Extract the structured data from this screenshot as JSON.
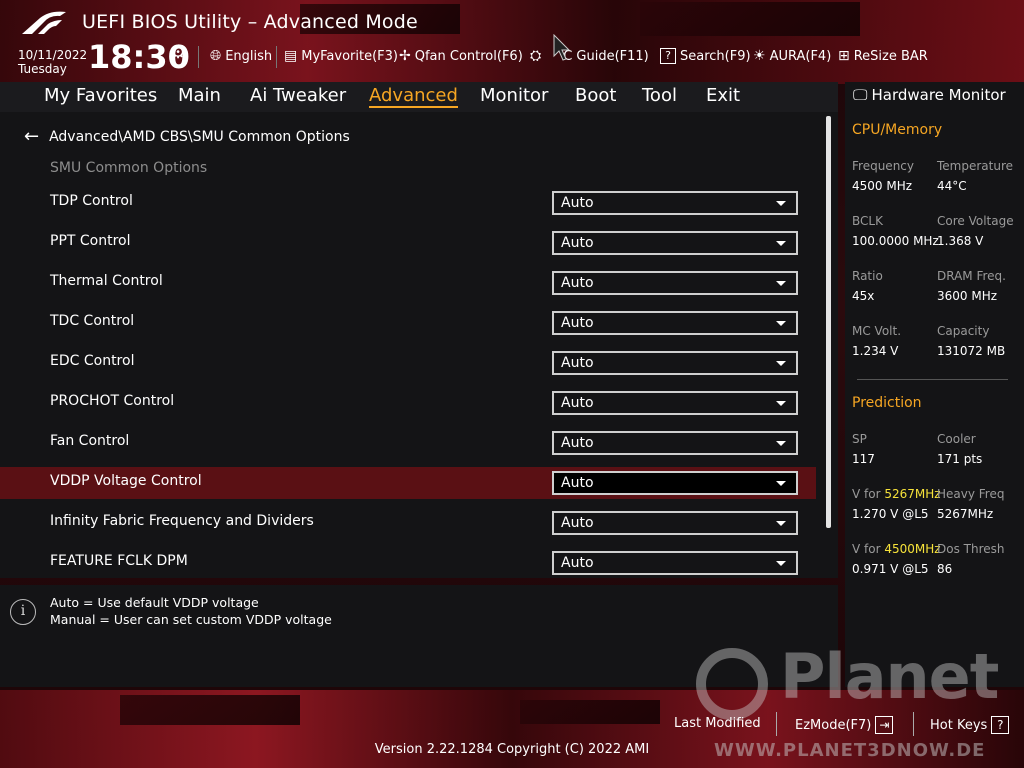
{
  "header": {
    "title": "UEFI BIOS Utility – Advanced Mode",
    "date": "10/11/2022",
    "day": "Tuesday",
    "time": "18:30",
    "toolbar": [
      {
        "label": "English",
        "icon": "globe-icon"
      },
      {
        "label": "MyFavorite(F3)",
        "icon": "favorite-icon"
      },
      {
        "label": "Qfan Control(F6)",
        "icon": "fan-icon"
      },
      {
        "label": "C Guide(F11)",
        "icon": "oc-guide-icon"
      },
      {
        "label": "Search(F9)",
        "icon": "search-icon"
      },
      {
        "label": "AURA(F4)",
        "icon": "aura-icon"
      },
      {
        "label": "ReSize BAR",
        "icon": "resize-bar-icon"
      }
    ]
  },
  "nav": {
    "tabs": [
      "My Favorites",
      "Main",
      "Ai Tweaker",
      "Advanced",
      "Monitor",
      "Boot",
      "Tool",
      "Exit"
    ],
    "active": "Advanced"
  },
  "main": {
    "breadcrumb": "Advanced\\AMD CBS\\SMU Common Options",
    "section_label": "SMU Common Options",
    "options": [
      {
        "label": "TDP Control",
        "value": "Auto"
      },
      {
        "label": "PPT Control",
        "value": "Auto"
      },
      {
        "label": "Thermal Control",
        "value": "Auto"
      },
      {
        "label": "TDC Control",
        "value": "Auto"
      },
      {
        "label": "EDC Control",
        "value": "Auto"
      },
      {
        "label": "PROCHOT Control",
        "value": "Auto"
      },
      {
        "label": "Fan Control",
        "value": "Auto"
      },
      {
        "label": "VDDP Voltage Control",
        "value": "Auto"
      },
      {
        "label": "Infinity Fabric Frequency and Dividers",
        "value": "Auto"
      },
      {
        "label": "FEATURE FCLK DPM",
        "value": "Auto"
      }
    ],
    "selected_index": 7
  },
  "help": {
    "lines": [
      "Auto = Use default VDDP voltage",
      "Manual = User can set custom VDDP voltage"
    ]
  },
  "hw": {
    "title": "Hardware Monitor",
    "cpu_section": "CPU/Memory",
    "cpu": [
      {
        "l1": "Frequency",
        "v1": "4500 MHz",
        "l2": "Temperature",
        "v2": "44°C"
      },
      {
        "l1": "BCLK",
        "v1": "100.0000 MHz",
        "l2": "Core Voltage",
        "v2": "1.368 V"
      },
      {
        "l1": "Ratio",
        "v1": "45x",
        "l2": "DRAM Freq.",
        "v2": "3600 MHz"
      },
      {
        "l1": "MC Volt.",
        "v1": "1.234 V",
        "l2": "Capacity",
        "v2": "131072 MB"
      }
    ],
    "prediction_section": "Prediction",
    "prediction": {
      "sp_label": "SP",
      "sp": "117",
      "cooler_label": "Cooler",
      "cooler": "171 pts",
      "v_for_label": "V for",
      "f1": "5267MHz",
      "v1": "1.270 V @L5",
      "heavy_label": "Heavy Freq",
      "heavy": "5267MHz",
      "f2": "4500MHz",
      "v2": "0.971 V @L5",
      "dos_label": "Dos Thresh",
      "dos": "86"
    }
  },
  "footer": {
    "last_modified": "Last Modified",
    "ezmode": "EzMode(F7)",
    "hotkeys": "Hot Keys",
    "hotkeys_key": "?",
    "version": "Version 2.22.1284 Copyright (C) 2022 AMI"
  },
  "watermark": {
    "brand": "Planet",
    "url": "WWW.PLANET3DNOW.DE"
  },
  "colors": {
    "accent": "#f6a623",
    "selected_row": "#5a1014",
    "highlight": "#f6e23a"
  }
}
